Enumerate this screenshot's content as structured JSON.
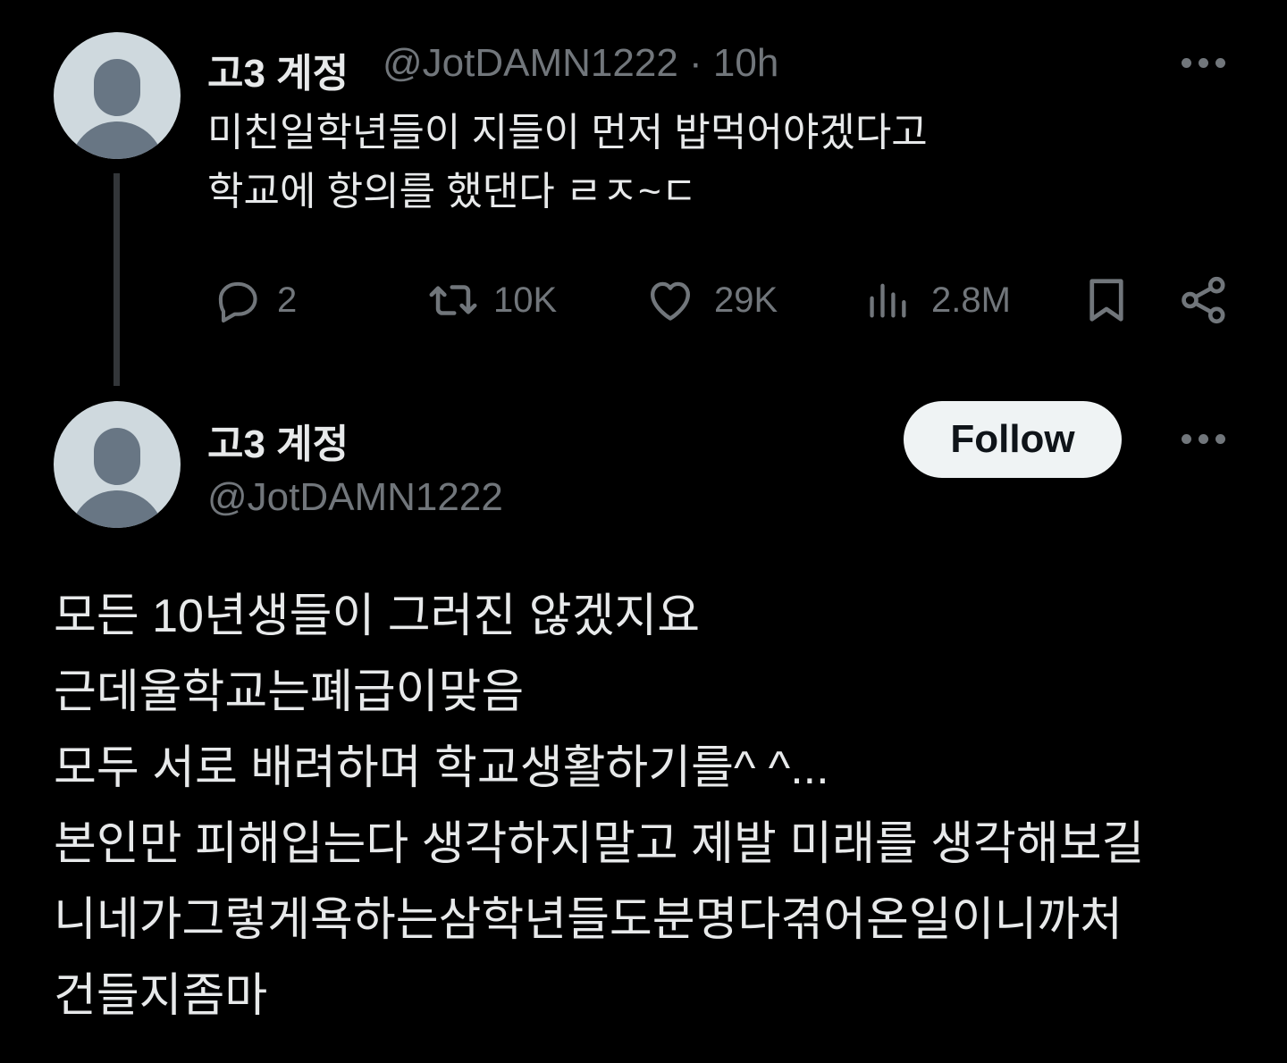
{
  "parent_tweet": {
    "display_name": "고3 계정",
    "handle": "@JotDAMN1222",
    "separator": "·",
    "time": "10h",
    "text_lines": [
      "미친일학년들이 지들이 먼저 밥먹어야겠다고",
      "학교에 항의를 했댄다 ㄹㅈ~ㄷ"
    ],
    "actions": {
      "replies": "2",
      "reposts": "10K",
      "likes": "29K",
      "views": "2.8M"
    },
    "icons": [
      "avatar",
      "more-options-icon",
      "reply-icon",
      "repost-icon",
      "like-icon",
      "views-icon",
      "bookmark-icon",
      "share-icon"
    ]
  },
  "reply_tweet": {
    "display_name": "고3 계정",
    "handle": "@JotDAMN1222",
    "follow_label": "Follow",
    "text_lines": [
      "모든 10년생들이 그러진 않겠지요",
      "근데울학교는폐급이맞음",
      "모두 서로 배려하며 학교생활하기를^ ^...",
      "본인만 피해입는다 생각하지말고 제발 미래를 생각해보길",
      "니네가그렇게욕하는삼학년들도분명다겪어온일이니까처",
      "건들지좀마"
    ],
    "icons": [
      "avatar",
      "more-options-icon"
    ]
  },
  "colors": {
    "background": "#000000",
    "primary_text": "#e7e9ea",
    "secondary_text": "#71767b",
    "thread_line": "#333639",
    "follow_button_bg": "#eff3f4",
    "follow_button_text": "#0f1419"
  }
}
